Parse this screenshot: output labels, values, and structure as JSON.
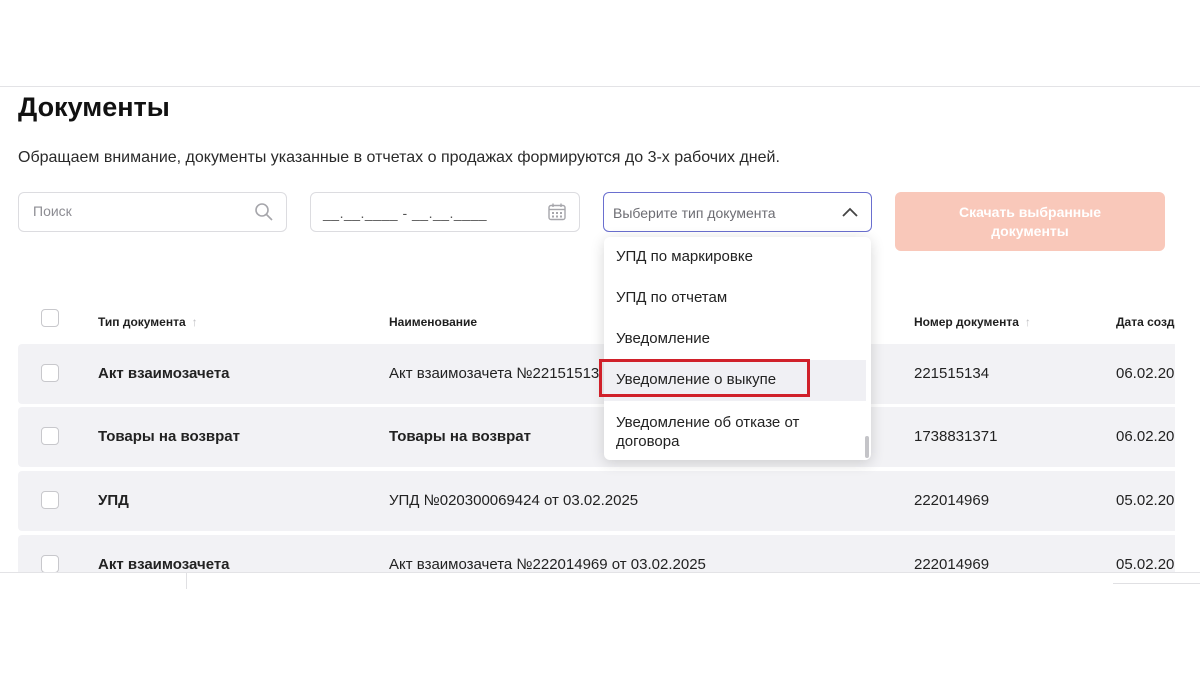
{
  "page": {
    "title": "Документы",
    "notice": "Обращаем внимание, документы указанные в отчетах о продажах формируются до 3-х рабочих дней."
  },
  "filters": {
    "search_placeholder": "Поиск",
    "date_range": "__.__.____ - __.__.____",
    "doc_type_placeholder": "Выберите тип документа",
    "download_button": "Скачать выбранные документы"
  },
  "table": {
    "headers": [
      "Тип документа",
      "Наименование",
      "Номер документа",
      "Дата созда"
    ],
    "rows": [
      {
        "type": "Акт взаимозачета",
        "name": "Акт взаимозачета №22151513",
        "number": "221515134",
        "date": "06.02.20"
      },
      {
        "type": "Товары на возврат",
        "name": "Товары на возврат",
        "number": "1738831371",
        "date": "06.02.20"
      },
      {
        "type": "УПД",
        "name": "УПД №020300069424 от 03.02.2025",
        "number": "222014969",
        "date": "05.02.20"
      },
      {
        "type": "Акт взаимозачета",
        "name": "Акт взаимозачета №222014969 от 03.02.2025",
        "number": "222014969",
        "date": "05.02.20"
      }
    ]
  },
  "dropdown": {
    "options": [
      "УПД по маркировке",
      "УПД по отчетам",
      "Уведомление",
      "Уведомление о выкупе",
      "Уведомление об отказе от договора"
    ],
    "highlighted_index": 3
  },
  "colors": {
    "accent_border": "#6a6fcf",
    "download_button_bg": "#f9c8ba",
    "highlight_box": "#d0202a",
    "row_bg": "#f2f2f5"
  }
}
